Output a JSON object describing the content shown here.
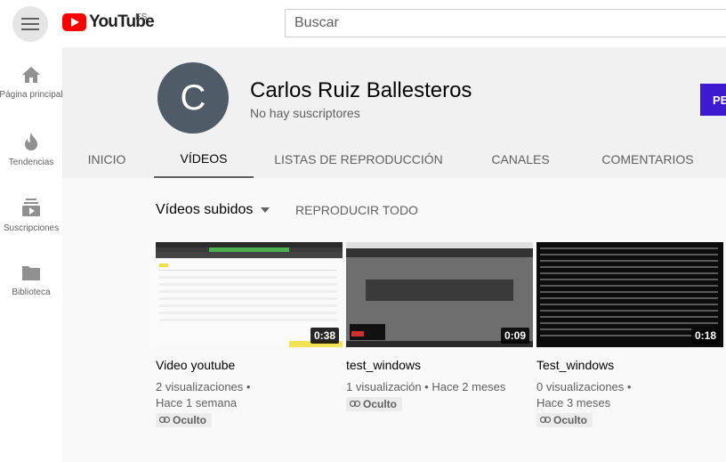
{
  "header": {
    "logo_text": "YouTube",
    "country": "ES",
    "search_placeholder": "Buscar"
  },
  "sidebar": {
    "items": [
      {
        "label": "Página principal",
        "icon": "home-icon"
      },
      {
        "label": "Tendencias",
        "icon": "trending-icon"
      },
      {
        "label": "Suscripciones",
        "icon": "subscriptions-icon"
      },
      {
        "label": "Biblioteca",
        "icon": "library-icon"
      }
    ]
  },
  "channel": {
    "initial": "C",
    "name": "Carlos Ruiz Ballesteros",
    "subscribers": "No hay suscriptores",
    "button_label": "PE"
  },
  "tabs": [
    {
      "label": "INICIO"
    },
    {
      "label": "VÍDEOS"
    },
    {
      "label": "LISTAS DE REPRODUCCIÓN"
    },
    {
      "label": "CANALES"
    },
    {
      "label": "COMENTARIOS"
    }
  ],
  "active_tab": "VÍDEOS",
  "videos_section": {
    "sort_label": "Vídeos subidos",
    "play_all": "REPRODUCIR TODO"
  },
  "videos": [
    {
      "title": "Video youtube",
      "views": "2 visualizaciones •",
      "age": "Hace 1 semana",
      "visibility": "Oculto",
      "duration": "0:38"
    },
    {
      "title": "test_windows",
      "views": "1 visualización • Hace 2 meses",
      "age": "",
      "visibility": "Oculto",
      "duration": "0:09"
    },
    {
      "title": "Test_windows",
      "views": "0 visualizaciones •",
      "age": "Hace 3 meses",
      "visibility": "Oculto",
      "duration": "0:18"
    }
  ],
  "colors": {
    "brand_red": "#ff0000",
    "subscribe_blue": "#3d19d1",
    "avatar_bg": "#4f5b66"
  }
}
